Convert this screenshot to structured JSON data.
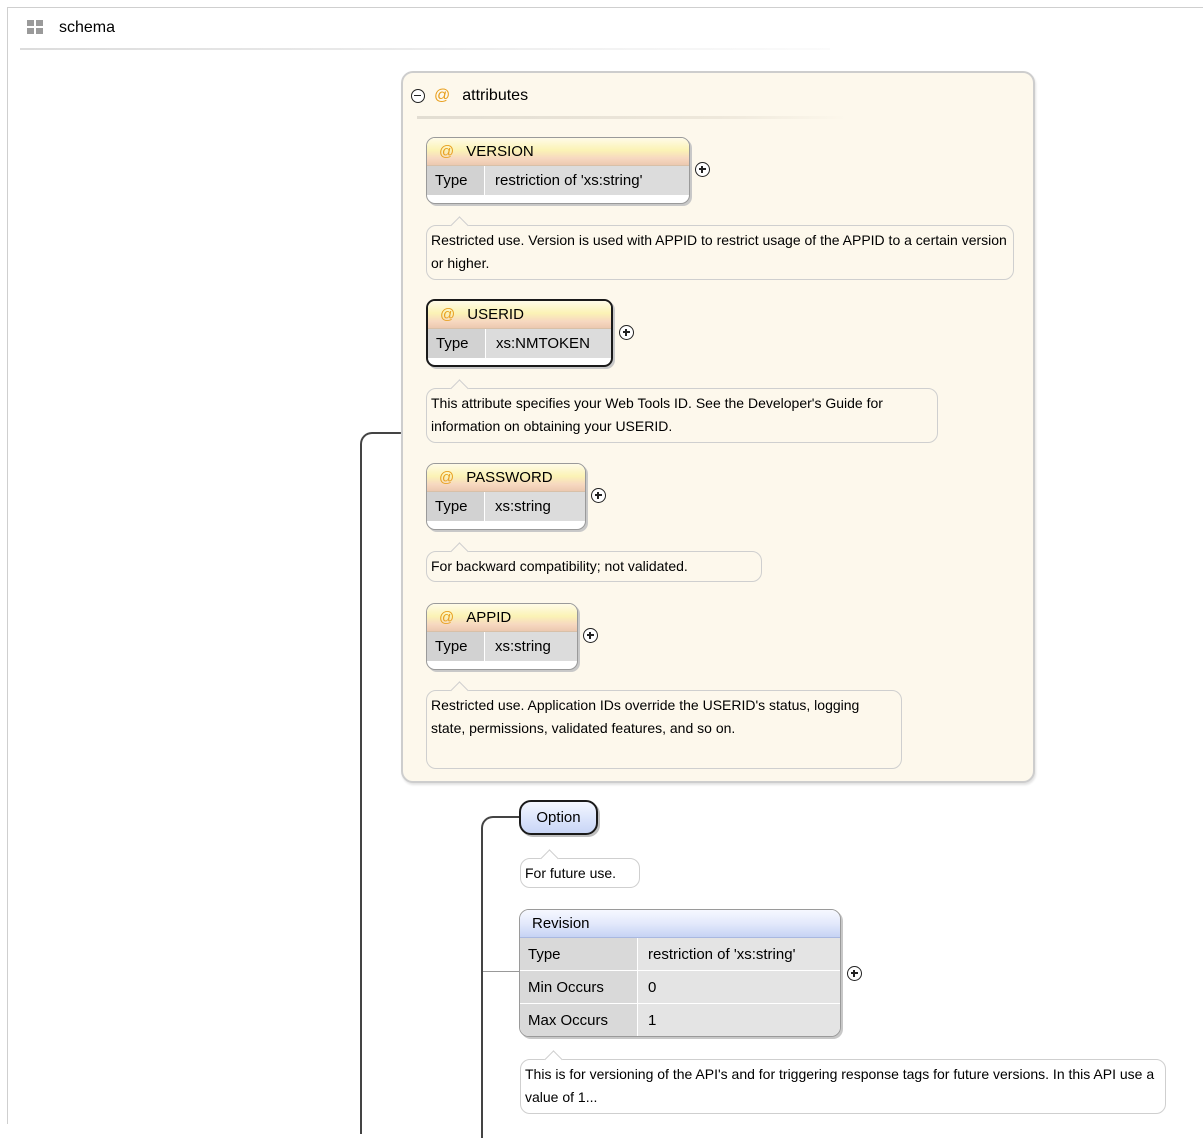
{
  "header": {
    "title": "schema"
  },
  "attributes_group": {
    "title": "attributes",
    "attributes": [
      {
        "name": "VERSION",
        "type_label": "Type",
        "type_value": "restriction of 'xs:string'",
        "doc": "Restricted use. Version is used with APPID to restrict usage of the APPID to a certain version or higher."
      },
      {
        "name": "USERID",
        "type_label": "Type",
        "type_value": "xs:NMTOKEN",
        "doc": "This attribute specifies your Web Tools ID. See the Developer's Guide for information on obtaining your USERID."
      },
      {
        "name": "PASSWORD",
        "type_label": "Type",
        "type_value": "xs:string",
        "doc": "For backward compatibility; not validated."
      },
      {
        "name": "APPID",
        "type_label": "Type",
        "type_value": "xs:string",
        "doc": "Restricted use. Application IDs override the USERID's status, logging state, permissions, validated features, and so on."
      }
    ]
  },
  "option": {
    "label": "Option",
    "doc": "For future use."
  },
  "revision": {
    "name": "Revision",
    "rows": [
      {
        "key": "Type",
        "value": "restriction of 'xs:string'"
      },
      {
        "key": "Min Occurs",
        "value": "0"
      },
      {
        "key": "Max Occurs",
        "value": "1"
      }
    ],
    "doc": "This is for versioning of the API's and for triggering response tags for future versions. In this API use a value of 1..."
  },
  "colors": {
    "attribute_icon": "#e8a020",
    "group_background": "#fdf8ec",
    "element_header": "#c9d6f6"
  },
  "icons": {
    "header": "grid-icon",
    "collapse": "minus-circle-icon",
    "expand": "plus-circle-icon",
    "attribute": "at-icon"
  }
}
